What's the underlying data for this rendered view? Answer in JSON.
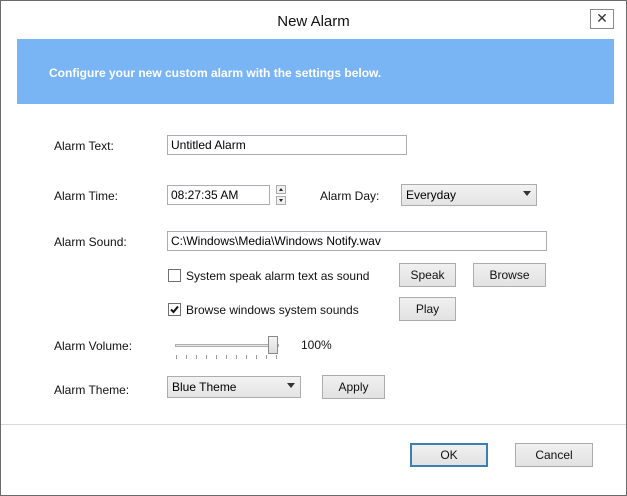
{
  "window": {
    "title": "New Alarm",
    "close_glyph": "✕"
  },
  "banner": {
    "text": "Configure your new custom alarm with the settings below."
  },
  "form": {
    "alarm_text_label": "Alarm Text:",
    "alarm_text_value": "Untitled Alarm",
    "alarm_time_label": "Alarm Time:",
    "alarm_time_value": "08:27:35 AM",
    "alarm_day_label": "Alarm Day:",
    "alarm_day_value": "Everyday",
    "alarm_sound_label": "Alarm Sound:",
    "alarm_sound_value": "C:\\Windows\\Media\\Windows Notify.wav",
    "speak_checkbox_label": "System speak alarm text as sound",
    "speak_checked": false,
    "speak_button": "Speak",
    "browse_button": "Browse",
    "browse_sounds_label": "Browse windows system sounds",
    "browse_sounds_checked": true,
    "play_button": "Play",
    "alarm_volume_label": "Alarm Volume:",
    "alarm_volume_value": "100%",
    "alarm_volume_level": 1.0,
    "alarm_theme_label": "Alarm Theme:",
    "alarm_theme_value": "Blue Theme",
    "apply_button": "Apply"
  },
  "footer": {
    "ok_button": "OK",
    "cancel_button": "Cancel"
  },
  "colors": {
    "banner": "#79b4f5",
    "default_button_border": "#3c7fb1"
  }
}
